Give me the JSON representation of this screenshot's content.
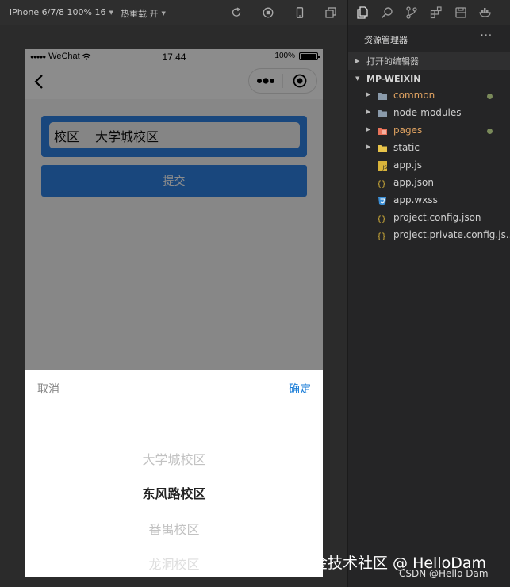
{
  "toolbar": {
    "device": "iPhone 6/7/8 100% 16",
    "hot_reload": "热重载 开",
    "icons": [
      "refresh-icon",
      "stop-icon",
      "phone-icon",
      "window-icon"
    ]
  },
  "status_bar": {
    "carrier": "WeChat",
    "time": "17:44",
    "battery": "100%"
  },
  "form": {
    "label": "校区",
    "value": "大学城校区",
    "submit_label": "提交"
  },
  "picker": {
    "cancel": "取消",
    "confirm": "确定",
    "options": [
      "大学城校区",
      "东风路校区",
      "番禺校区",
      "龙洞校区"
    ],
    "selected": "东风路校区"
  },
  "explorer": {
    "title": "资源管理器",
    "more": "···",
    "open_editors": "打开的编辑器",
    "project": "MP-WEIXIN",
    "items": [
      {
        "name": "common",
        "kind": "folder",
        "modified": true
      },
      {
        "name": "node-modules",
        "kind": "folder",
        "modified": false
      },
      {
        "name": "pages",
        "kind": "folder",
        "modified": true
      },
      {
        "name": "static",
        "kind": "folder",
        "modified": false
      },
      {
        "name": "app.js",
        "kind": "js"
      },
      {
        "name": "app.json",
        "kind": "json"
      },
      {
        "name": "app.wxss",
        "kind": "css"
      },
      {
        "name": "project.config.json",
        "kind": "json"
      },
      {
        "name": "project.private.config.js...",
        "kind": "json"
      }
    ]
  },
  "watermark": {
    "main": "掘金技术社区 @ HelloDam",
    "sub": "CSDN @Hello Dam"
  },
  "colors": {
    "accent": "#2f82e4",
    "confirm": "#1e7fd8",
    "modified_folder": "#e2a462",
    "editor_bg": "#252526"
  }
}
